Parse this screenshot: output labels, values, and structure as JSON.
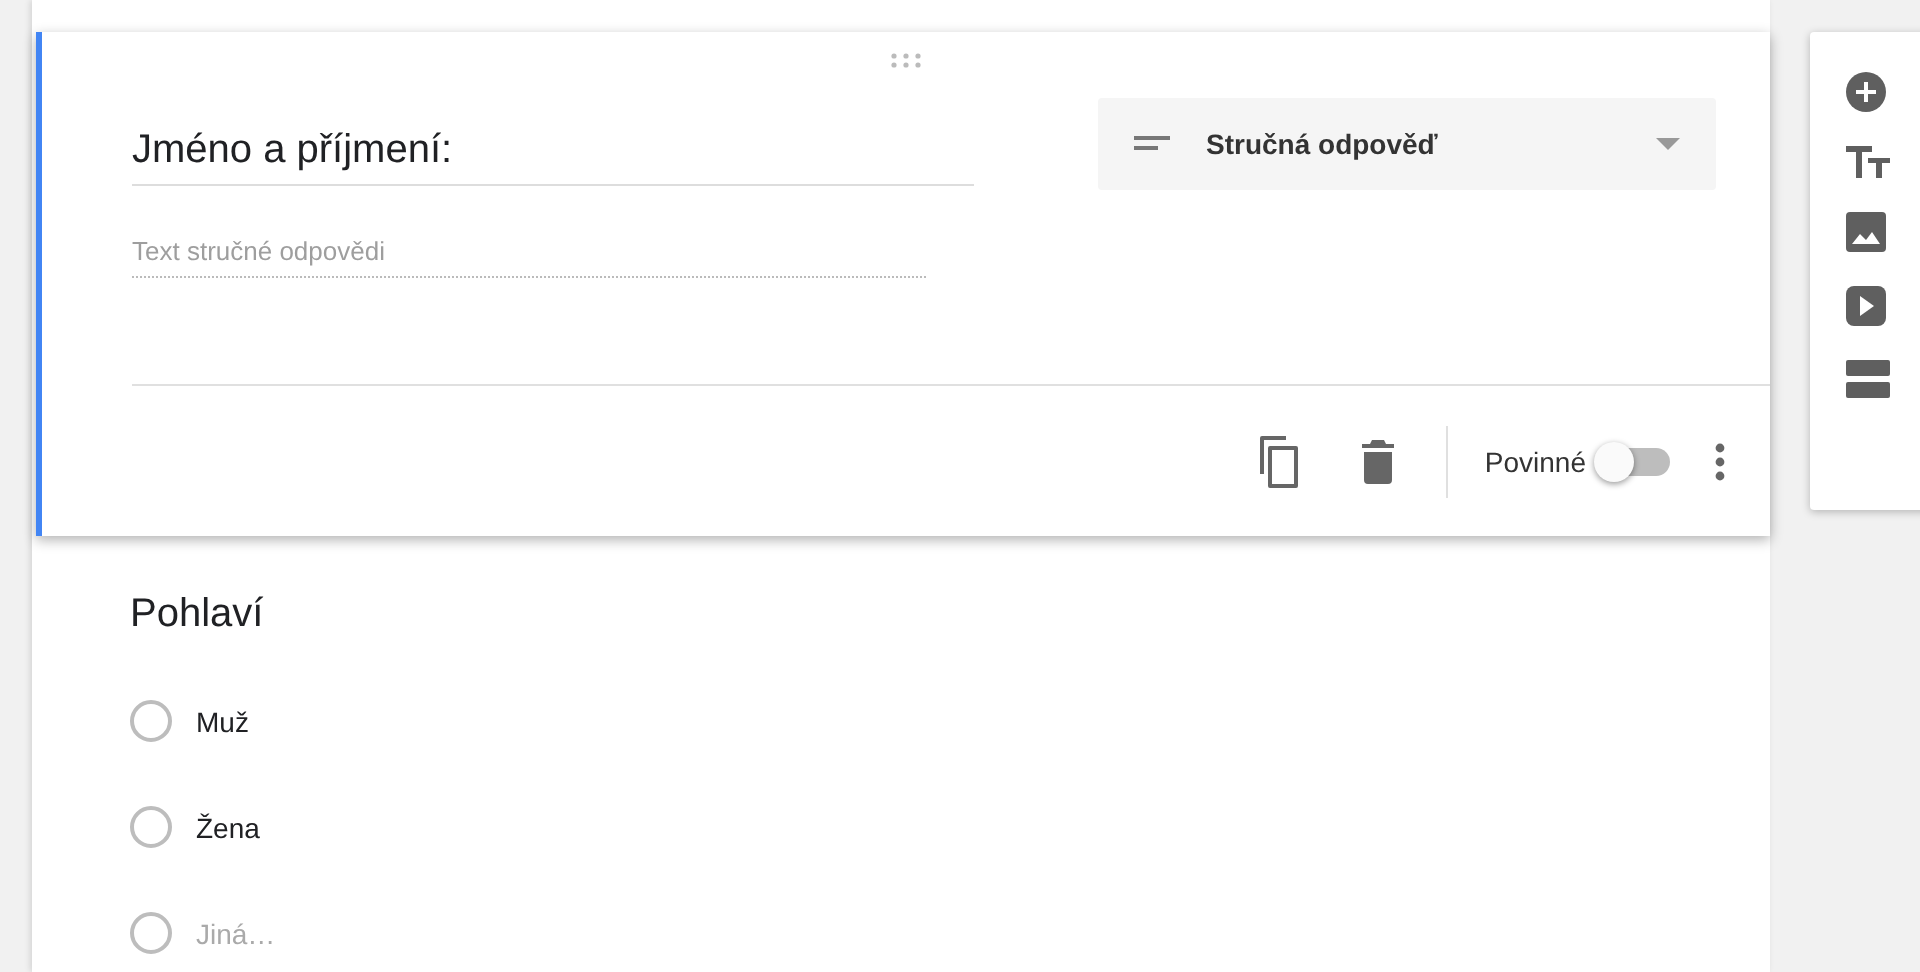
{
  "question_card": {
    "active": true,
    "title": "Jméno a příjmení:",
    "answer": {
      "placeholder": "Text stručné odpovědi"
    },
    "type_dropdown": {
      "label": "Stručná odpověď"
    },
    "required": {
      "label": "Povinné",
      "on": false
    }
  },
  "second_card": {
    "title": "Pohlaví",
    "options": [
      {
        "kind": "option",
        "label": "Muž",
        "selected": false
      },
      {
        "kind": "option",
        "label": "Žena",
        "selected": false
      },
      {
        "kind": "other",
        "label": "Jiná…",
        "selected": false
      }
    ]
  },
  "toolbar": [
    {
      "kind": "add"
    },
    {
      "kind": "title"
    },
    {
      "kind": "image"
    },
    {
      "kind": "video"
    },
    {
      "kind": "section"
    }
  ]
}
